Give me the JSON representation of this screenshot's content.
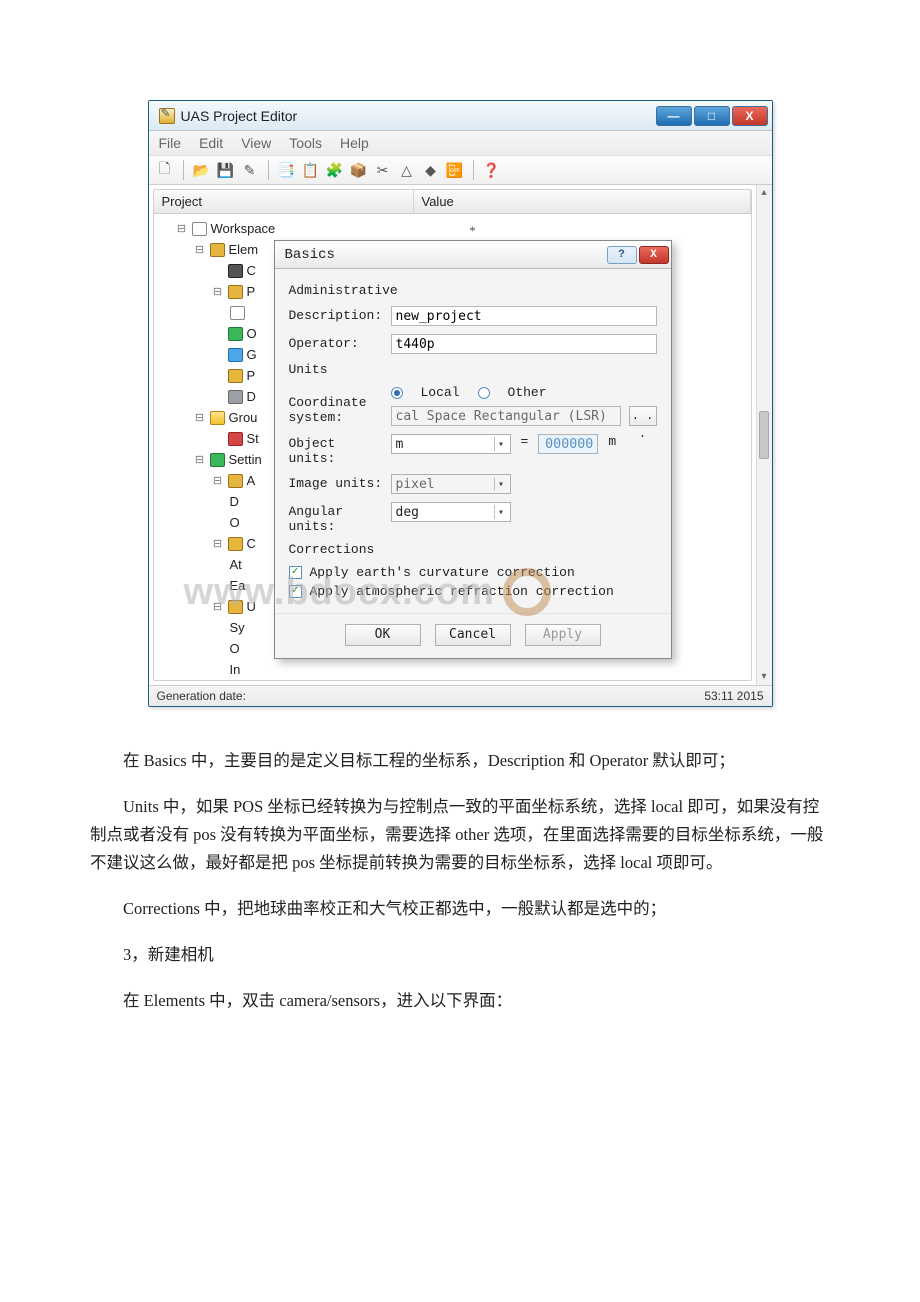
{
  "window": {
    "title": "UAS Project Editor",
    "controls": {
      "min": "—",
      "max": "□",
      "close": "X"
    }
  },
  "menu": [
    "File",
    "Edit",
    "View",
    "Tools",
    "Help"
  ],
  "toolbar_icons": [
    "🗋",
    "📂",
    "💾",
    "✎",
    "📑",
    "📋",
    "🧩",
    "📦",
    "✂",
    "△",
    "◆",
    "📴",
    "❓"
  ],
  "columns": {
    "project": "Project",
    "value": "Value"
  },
  "tree": {
    "root": "Workspace",
    "n_elem": "Elem",
    "n_elem_cam": "C",
    "n_p": "P",
    "n_o": "O",
    "n_g": "G",
    "n_p2": "P",
    "n_d": "D",
    "n_group": "Grou",
    "n_group_s": "St",
    "n_settings": "Settin",
    "n_a": "A",
    "n_a_d": "D",
    "n_a_o": "O",
    "n_c": "C",
    "n_c_at": "At",
    "n_c_ea": "Ea",
    "n_u": "U",
    "n_u_sy": "Sy",
    "n_u_o": "O",
    "n_u_in": "In"
  },
  "status": {
    "left": "Generation date:",
    "right": "53:11 2015"
  },
  "dialog": {
    "title": "Basics",
    "star": "*",
    "section_admin": "Administrative",
    "lbl_description": "Description:",
    "val_description": "new_project",
    "lbl_operator": "Operator:",
    "val_operator": "t440p",
    "section_units": "Units",
    "lbl_coord": "Coordinate system:",
    "radio_local": "Local",
    "radio_other": "Other",
    "coord_value": "cal Space Rectangular (LSR)",
    "browse": ". . .",
    "lbl_obj": "Object units:",
    "obj_combo": "m",
    "obj_eq": "=",
    "obj_num": "000000",
    "obj_suffix": "m",
    "lbl_img": "Image units:",
    "img_combo": "pixel",
    "lbl_ang": "Angular units:",
    "ang_combo": "deg",
    "section_corr": "Corrections",
    "chk_curv": "Apply earth's curvature correction",
    "chk_atm": "Apply atmospheric refraction correction",
    "btn_ok": "OK",
    "btn_cancel": "Cancel",
    "btn_apply": "Apply"
  },
  "watermark": "www.bdocx.com",
  "doc": {
    "p1": "在 Basics 中，主要目的是定义目标工程的坐标系，Description 和 Operator 默认即可；",
    "p2": "Units 中，如果 POS 坐标已经转换为与控制点一致的平面坐标系统，选择 local 即可，如果没有控制点或者没有 pos 没有转换为平面坐标，需要选择 other 选项，在里面选择需要的目标坐标系统，一般不建议这么做，最好都是把 pos 坐标提前转换为需要的目标坐标系，选择 local 项即可。",
    "p3": "Corrections 中，把地球曲率校正和大气校正都选中，一般默认都是选中的；",
    "p4": "3，新建相机",
    "p5": "在 Elements 中，双击 camera/sensors，进入以下界面："
  }
}
